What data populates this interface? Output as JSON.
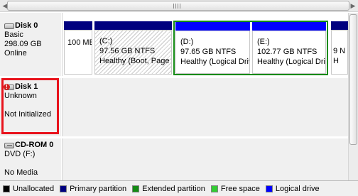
{
  "colors": {
    "unallocated": "#000000",
    "primary": "#00007f",
    "extended": "#138a13",
    "free": "#33cc33",
    "logical": "#0000ff",
    "selection": "#e8131c"
  },
  "disks": [
    {
      "name": "Disk 0",
      "icon": "hard-disk-icon",
      "type": "Basic",
      "size": "298.09 GB",
      "status": "Online",
      "partitions": [
        {
          "size": "100 ME",
          "fs": "",
          "status": ""
        },
        {
          "letter": "(C:)",
          "size": "97.56 GB NTFS",
          "status": "Healthy (Boot, Page F"
        },
        {
          "letter": "(D:)",
          "size": "97.65 GB NTFS",
          "status": "Healthy (Logical Driv"
        },
        {
          "letter": "(E:)",
          "size": "102.77 GB NTFS",
          "status": "Healthy (Logical Driv"
        },
        {
          "size": "9 N",
          "status": "H"
        }
      ]
    },
    {
      "name": "Disk 1",
      "icon": "hard-disk-warning-icon",
      "type": "Unknown",
      "status": "Not Initialized"
    },
    {
      "name": "CD-ROM 0",
      "icon": "cd-rom-icon",
      "type": "DVD (F:)",
      "status": "No Media"
    }
  ],
  "legend": [
    {
      "label": "Unallocated",
      "color": "#000000"
    },
    {
      "label": "Primary partition",
      "color": "#00007f"
    },
    {
      "label": "Extended partition",
      "color": "#138a13"
    },
    {
      "label": "Free space",
      "color": "#33cc33"
    },
    {
      "label": "Logical drive",
      "color": "#0000ff"
    }
  ]
}
